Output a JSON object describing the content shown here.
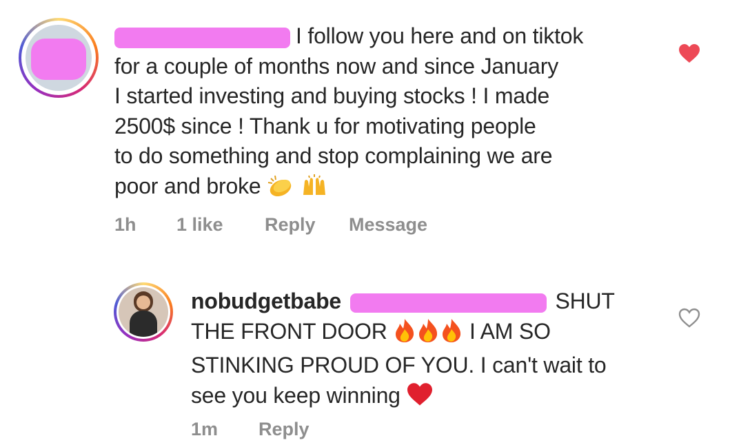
{
  "comment": {
    "text_lines": [
      "I follow you here and on tiktok",
      "for a couple of months now and since January",
      "I started investing and buying stocks ! I made",
      "2500$ since ! Thank u for motivating people",
      "to do something and stop complaining we are",
      "poor and broke"
    ],
    "time": "1h",
    "likes": "1 like",
    "reply_label": "Reply",
    "message_label": "Message",
    "liked": true,
    "emojis": [
      "clapping-hands",
      "raising-hands"
    ]
  },
  "reply": {
    "username": "nobudgetbabe",
    "line1_end": "SHUT",
    "line2_start": "THE FRONT DOOR",
    "line2_end": "I AM SO",
    "line3": "STINKING PROUD OF YOU. I can't wait to",
    "line4": "see you keep winning",
    "time": "1m",
    "reply_label": "Reply",
    "liked": false,
    "emojis": [
      "fire",
      "fire",
      "fire",
      "red-heart"
    ]
  },
  "colors": {
    "text": "#262626",
    "meta": "#8e8e8e",
    "like_red": "#ed4956",
    "redaction": "#f27bf0"
  }
}
